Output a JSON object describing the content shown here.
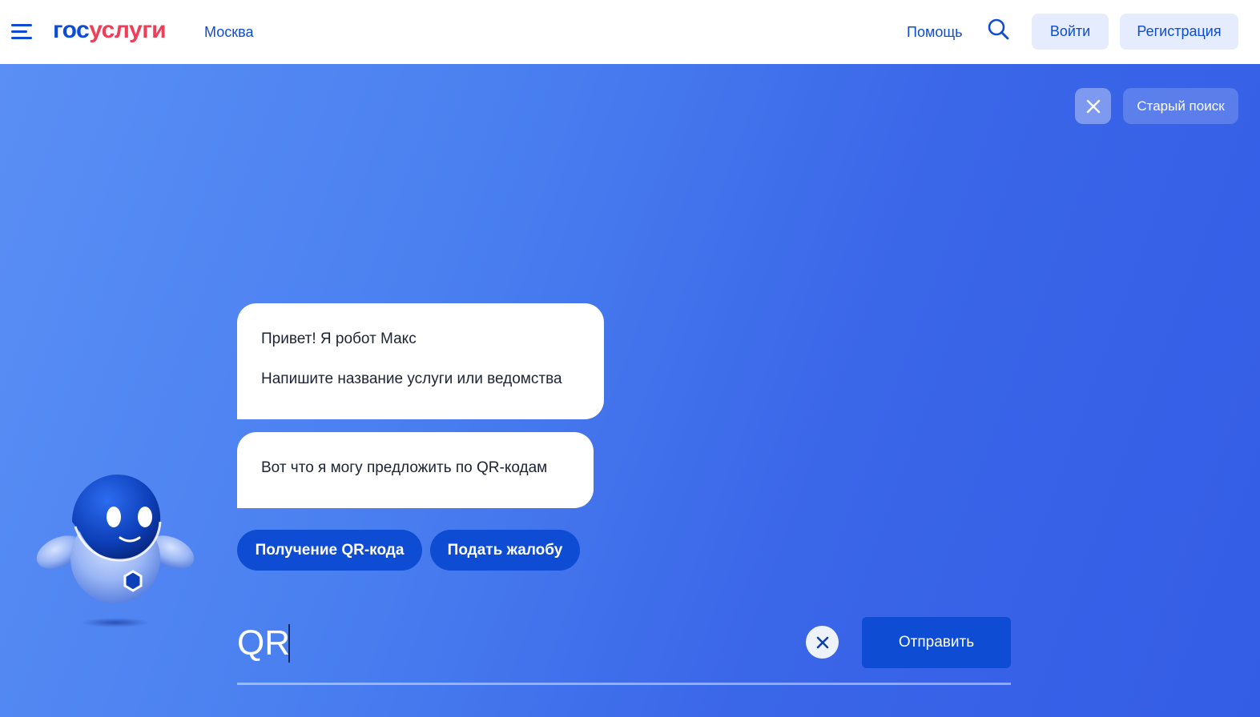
{
  "header": {
    "logo_part1": "гос",
    "logo_part2": "услуги",
    "city": "Москва",
    "help": "Помощь",
    "login": "Войти",
    "register": "Регистрация"
  },
  "top_actions": {
    "old_search": "Старый поиск"
  },
  "chat": {
    "greeting": "Привет! Я робот Макс",
    "prompt": "Напишите название услуги или ведомства",
    "suggestion_intro": "Вот что я могу предложить по QR-кодам",
    "chips": [
      "Получение QR-кода",
      "Подать жалобу"
    ]
  },
  "search": {
    "value": "QR",
    "send": "Отправить"
  },
  "colors": {
    "brand_blue": "#0d4cd3",
    "brand_red": "#ee3f58",
    "background_start": "#5a8ff5",
    "background_end": "#345de6"
  }
}
